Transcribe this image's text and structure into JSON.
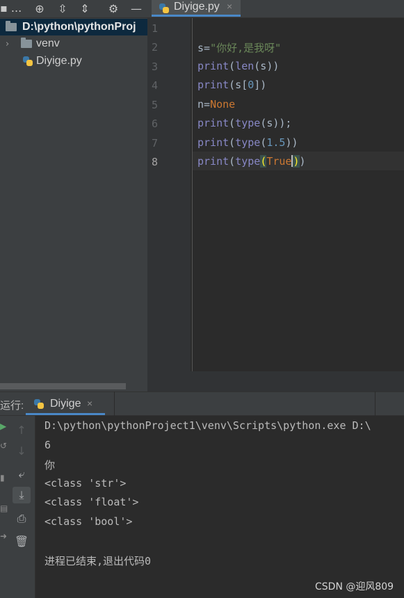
{
  "toolbar": {
    "project_menu": "▪ ...",
    "editor_tab_label": "Diyige.py",
    "editor_tab_close": "×"
  },
  "project": {
    "root_label": "D:\\python\\pythonProj",
    "items": [
      {
        "label": "venv"
      },
      {
        "label": "Diyige.py"
      }
    ]
  },
  "editor": {
    "line_numbers": [
      "1",
      "2",
      "3",
      "4",
      "5",
      "6",
      "7",
      "8"
    ]
  },
  "run": {
    "title": "运行:",
    "tab_label": "Diyige",
    "tab_close": "×",
    "output": [
      "D:\\python\\pythonProject1\\venv\\Scripts\\python.exe D:\\",
      "6",
      "你",
      "<class 'str'>",
      "<class 'float'>",
      "<class 'bool'>",
      "",
      "进程已结束,退出代码0"
    ]
  },
  "watermark": "CSDN @迎风809",
  "colors": {
    "accent": "#4a88c7",
    "editor_bg": "#2b2b2b",
    "panel_bg": "#3c3f41",
    "string": "#6a8759",
    "keyword": "#cc7832",
    "number": "#6897bb",
    "builtin": "#8888c6"
  }
}
